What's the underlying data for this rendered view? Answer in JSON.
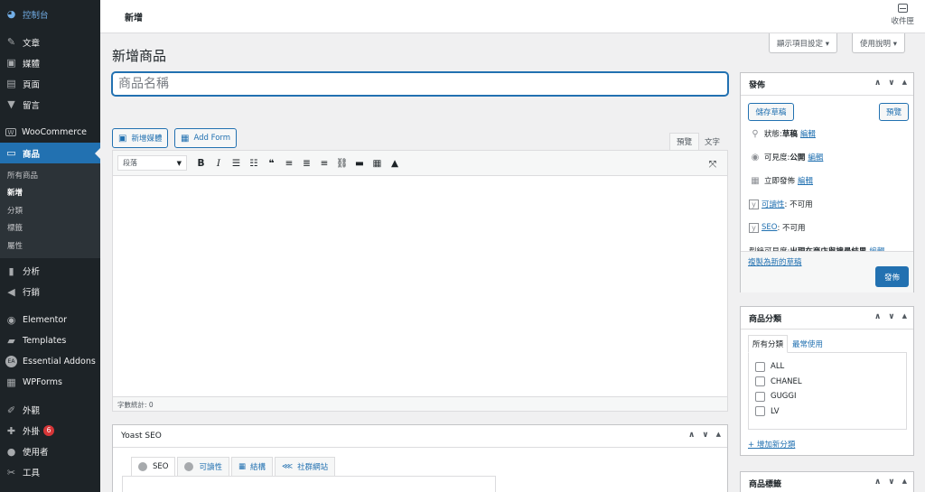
{
  "sidebar": {
    "dashboard": "控制台",
    "posts": "文章",
    "media": "媒體",
    "pages": "頁面",
    "comments": "留言",
    "woocommerce": "WooCommerce",
    "products": "商品",
    "products_sub": [
      "所有商品",
      "新增",
      "分類",
      "標籤",
      "屬性"
    ],
    "analytics": "分析",
    "marketing": "行銷",
    "elementor": "Elementor",
    "templates": "Templates",
    "essential_addons": "Essential Addons",
    "wpforms": "WPForms",
    "appearance": "外觀",
    "plugins": "外掛",
    "plugins_badge": "6",
    "users": "使用者",
    "tools": "工具"
  },
  "header": {
    "title": "新增",
    "inbox": "收件匣",
    "screen_options": "顯示項目設定 ▾",
    "help": "使用說明 ▾"
  },
  "page_title": "新增商品",
  "title_placeholder": "商品名稱",
  "editor": {
    "add_media": "新增媒體",
    "add_form": "Add Form",
    "tab_visual": "預覽",
    "tab_text": "文字",
    "format_value": "段落",
    "word_count": "字數統計: 0"
  },
  "yoast": {
    "title": "Yoast SEO",
    "tabs": [
      "SEO",
      "可讀性",
      "結構",
      "社群網站"
    ]
  },
  "publish": {
    "title": "發佈",
    "save_draft": "儲存草稿",
    "preview": "預覽",
    "status_label": "狀態: ",
    "status_value": "草稿",
    "visibility_label": "可見度: ",
    "visibility_value": "公開",
    "publish_time": "立即發佈",
    "edit": "編輯",
    "readability_link": "可讀性",
    "readability_value": ": 不可用",
    "seo_link": "SEO",
    "seo_value": ": 不可用",
    "catalog_label": "型錄可見度: ",
    "catalog_value": "出現在商店與搜尋結果",
    "copy_draft": "複製為新的草稿",
    "publish_btn": "發佈"
  },
  "categories": {
    "title": "商品分類",
    "tab_all": "所有分類",
    "tab_popular": "最常使用",
    "items": [
      "ALL",
      "CHANEL",
      "GUGGI",
      "LV"
    ],
    "add_new": "+ 增加新分類"
  },
  "tags": {
    "title": "商品標籤"
  }
}
